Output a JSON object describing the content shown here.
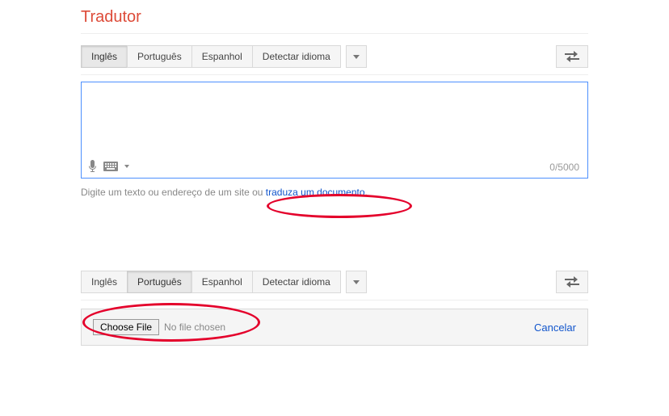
{
  "title": "Tradutor",
  "panel1": {
    "langs": [
      "Inglês",
      "Português",
      "Espanhol",
      "Detectar idioma"
    ],
    "active_index": 0,
    "counter": "0/5000",
    "help_prefix": "Digite um texto ou endereço de um site ou ",
    "help_link": "traduza um documento",
    "help_suffix": "."
  },
  "panel2": {
    "langs": [
      "Inglês",
      "Português",
      "Espanhol",
      "Detectar idioma"
    ],
    "active_index": 1,
    "choose_label": "Choose File",
    "no_file": "No file chosen",
    "cancel": "Cancelar"
  }
}
